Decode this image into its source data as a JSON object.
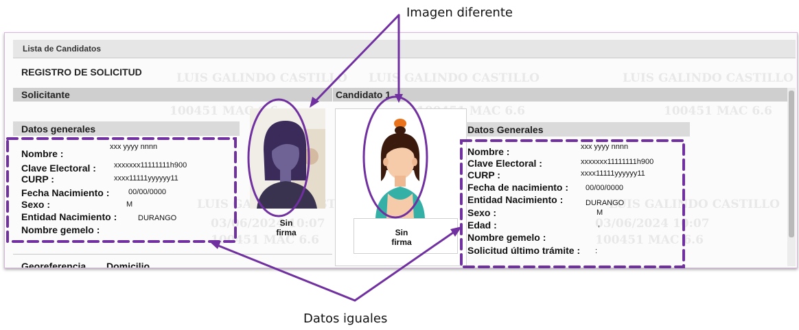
{
  "callouts": {
    "top": "Imagen diferente",
    "bottom": "Datos iguales"
  },
  "window": {
    "list_title": "Lista de Candidatos",
    "form_title": "REGISTRO DE SOLICITUD",
    "watermark_lines": [
      "100451 MAC 6.6",
      "LUIS GALINDO CASTILLO",
      "03/06/2024 10:07"
    ]
  },
  "solicitante": {
    "section": "Solicitante",
    "subsection": "Datos generales",
    "labels": {
      "nombre": "Nombre :",
      "clave": "Clave Electoral :",
      "curp": "CURP :",
      "fecha": "Fecha Nacimiento :",
      "sexo": "Sexo :",
      "entidad": "Entidad Nacimiento :",
      "gemelo": "Nombre gemelo :"
    },
    "values": {
      "nombre": "xxx yyyy nnnn",
      "clave": "xxxxxxx11111111h900",
      "curp": "xxxx11111yyyyyy11",
      "fecha": "00/00/0000",
      "sexo": "M",
      "entidad": "DURANGO"
    },
    "signature": "Sin firma",
    "bottom_tabs": [
      "Georeferencia",
      "Domicilio"
    ]
  },
  "candidato": {
    "section": "Candidato 1",
    "subsection": "Datos Generales",
    "labels": {
      "nombre": "Nombre :",
      "clave": "Clave Electoral :",
      "curp": "CURP :",
      "fecha": "Fecha de nacimiento :",
      "entidad": "Entidad Nacimiento :",
      "sexo": "Sexo :",
      "edad": "Edad :",
      "gemelo": "Nombre gemelo :",
      "ultimo": "Solicitud último trámite :"
    },
    "values": {
      "nombre": "xxx yyyy nnnn",
      "clave": "xxxxxxx11111111h900",
      "curp": "xxxx11111yyyyyy11",
      "fecha": "00/00/0000",
      "entidad": "DURANGO",
      "sexo": "M",
      "edad": ",",
      "ultimo": ":"
    },
    "signature": "Sin firma"
  },
  "colors": {
    "annotation": "#7030a0"
  }
}
